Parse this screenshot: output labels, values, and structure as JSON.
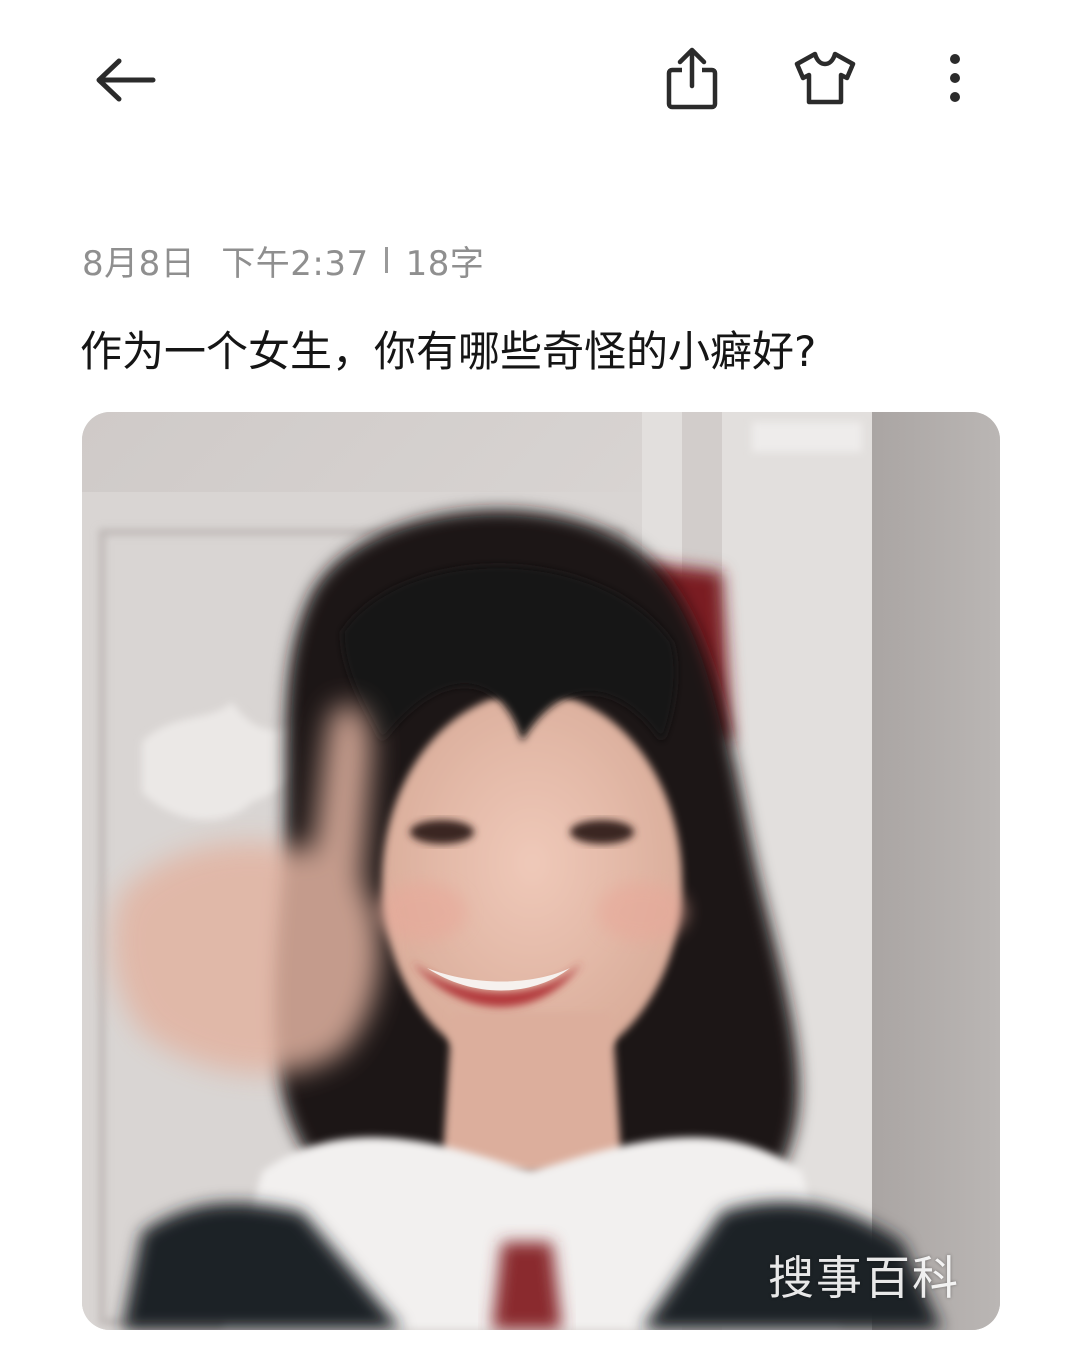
{
  "toolbar": {
    "back_icon": "arrow-left-icon",
    "share_icon": "share-icon",
    "theme_icon": "tshirt-icon",
    "more_icon": "more-vertical-icon"
  },
  "note": {
    "date": "8月8日",
    "time": "下午2:37",
    "word_count": "18字",
    "title": "作为一个女生，你有哪些奇怪的小癖好?",
    "image_description": "photo",
    "watermark": "搜事百科"
  },
  "colors": {
    "background": "#ffffff",
    "meta_text": "#8f8f8f",
    "title_text": "#151515",
    "icon": "#2b2b2b"
  }
}
